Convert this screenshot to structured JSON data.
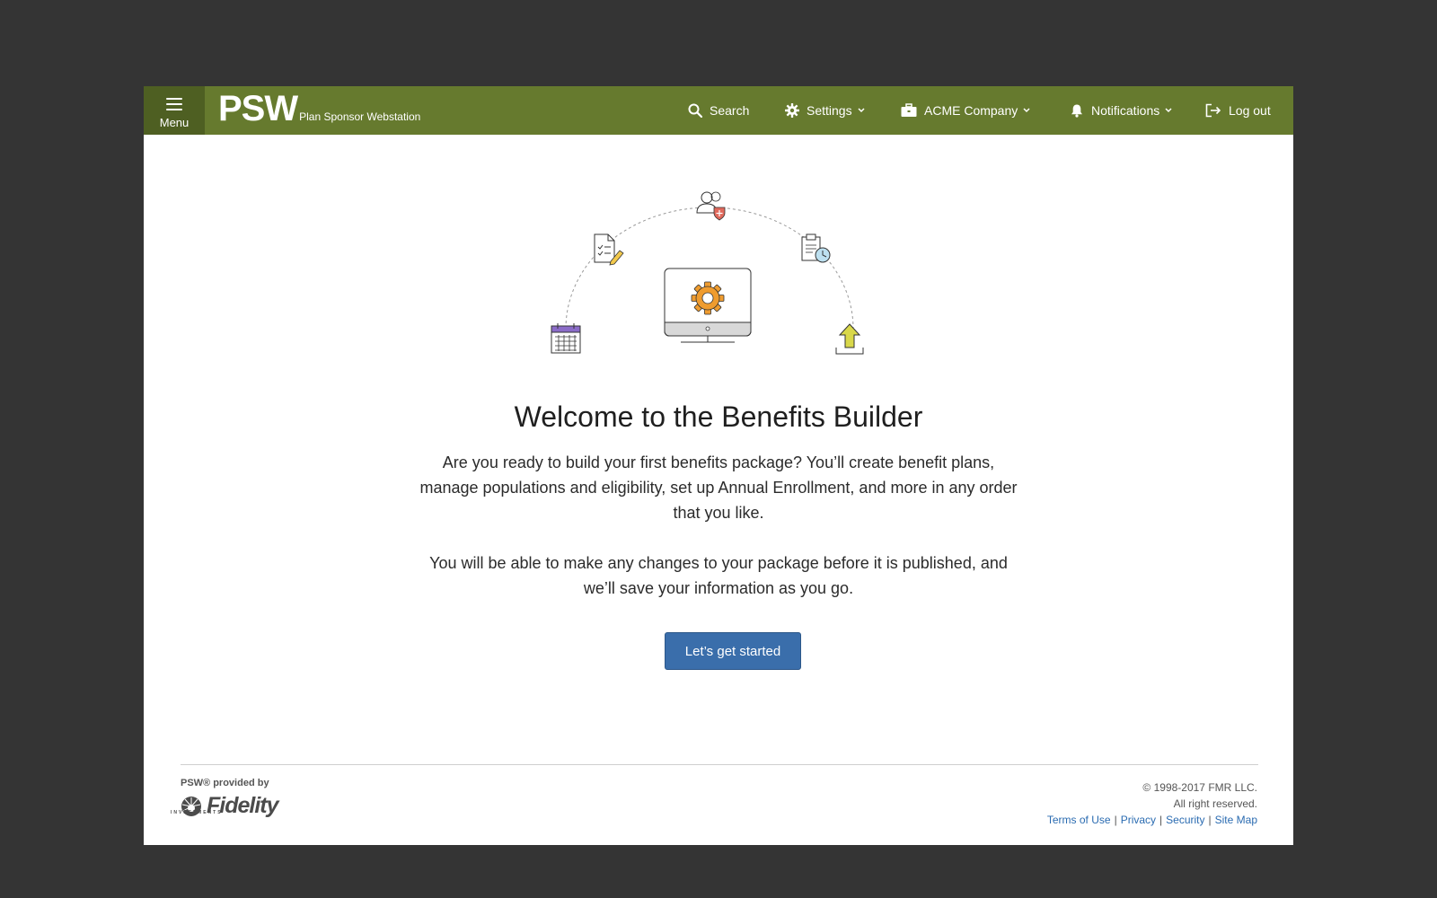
{
  "header": {
    "menu_label": "Menu",
    "logo_big": "PSW",
    "logo_small": "Plan Sponsor Webstation",
    "search_label": "Search",
    "settings_label": "Settings",
    "company_label": "ACME Company",
    "notifications_label": "Notifications",
    "logout_label": "Log out",
    "brand_color": "#667a2e"
  },
  "main": {
    "title": "Welcome to the Benefits Builder",
    "paragraph1": "Are you ready to build your first benefits package? You’ll create benefit plans, manage populations and eligibility, set up Annual Enrollment, and more in any order that you like.",
    "paragraph2": "You will be able to make any changes to your package before it is published, and we’ll save your information as you go.",
    "cta_label": "Let’s get started",
    "cta_color": "#3a6eab"
  },
  "footer": {
    "provided_by": "PSW® provided by",
    "fidelity": "Fidelity",
    "investments": "INVESTMENTS",
    "copyright": "© 1998-2017 FMR LLC.",
    "rights": "All right reserved.",
    "links": [
      "Terms of Use",
      "Privacy",
      "Security",
      "Site Map"
    ]
  }
}
